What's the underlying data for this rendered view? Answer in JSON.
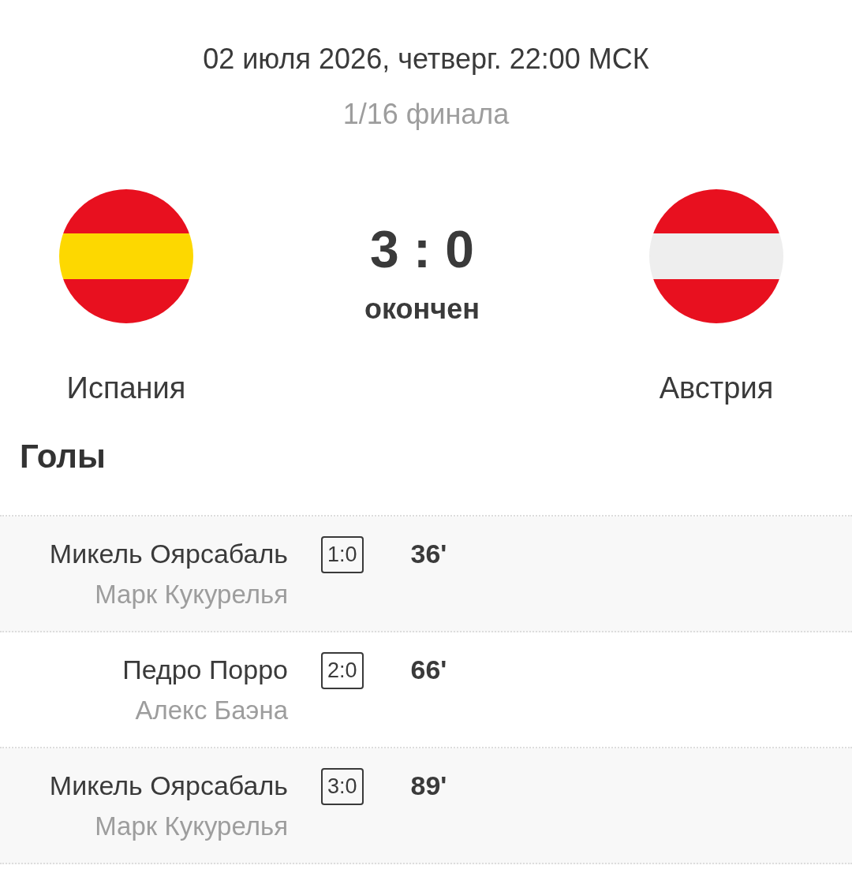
{
  "match": {
    "date": "02 июля 2026, четверг. 22:00 МСК",
    "round": "1/16 финала",
    "home": {
      "name": "Испания"
    },
    "score": "3 : 0",
    "status": "окончен",
    "away": {
      "name": "Австрия"
    }
  },
  "goals_title": "Голы",
  "goals": [
    {
      "scorer": "Микель Оярсабаль",
      "assist": "Марк Кукурелья",
      "score": "1:0",
      "minute": "36'"
    },
    {
      "scorer": "Педро Порро",
      "assist": "Алекс Баэна",
      "score": "2:0",
      "minute": "66'"
    },
    {
      "scorer": "Микель Оярсабаль",
      "assist": "Марк Кукурелья",
      "score": "3:0",
      "minute": "89'"
    }
  ]
}
